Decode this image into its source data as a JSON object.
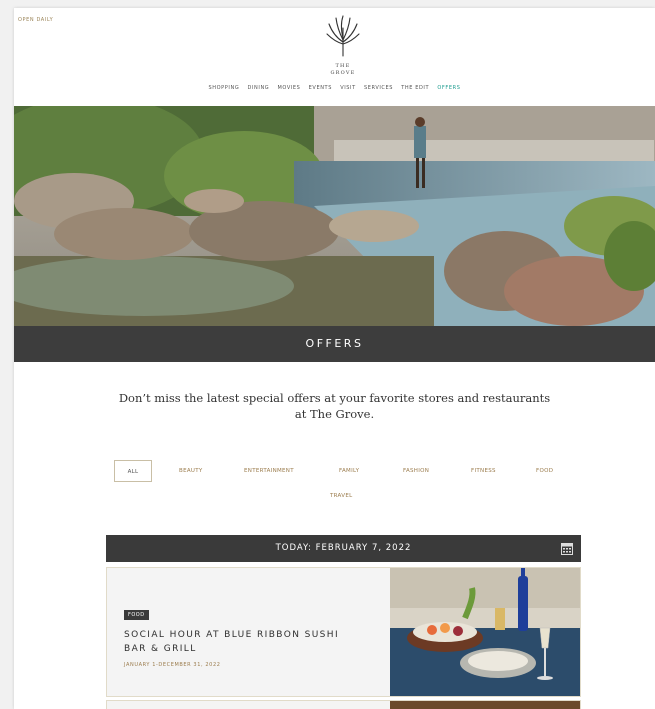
{
  "header": {
    "open_label": "OPEN DAILY",
    "logo_line1": "THE",
    "logo_line2": "GROVE"
  },
  "nav": {
    "items": [
      "SHOPPING",
      "DINING",
      "MOVIES",
      "EVENTS",
      "VISIT",
      "SERVICES",
      "THE EDIT",
      "OFFERS"
    ],
    "active": "OFFERS"
  },
  "banner": {
    "title": "OFFERS"
  },
  "intro": {
    "text": "Don’t miss the latest special offers at your favorite stores and restaurants at The Grove."
  },
  "filters": {
    "items": [
      "ALL",
      "BEAUTY",
      "ENTERTAINMENT",
      "FAMILY",
      "FASHION",
      "FITNESS",
      "FOOD",
      "TRAVEL"
    ],
    "selected": "ALL"
  },
  "date_bar": {
    "label": "TODAY: FEBRUARY 7, 2022",
    "icon": "calendar-icon"
  },
  "offers": [
    {
      "tag": "FOOD",
      "title": "SOCIAL HOUR AT BLUE RIBBON SUSHI BAR & GRILL",
      "dates": "JANUARY 1-DECEMBER 31, 2022"
    }
  ],
  "colors": {
    "accent": "#1c9c8f",
    "gold": "#9b7c4d",
    "dark_bar": "#3d3d3d"
  }
}
